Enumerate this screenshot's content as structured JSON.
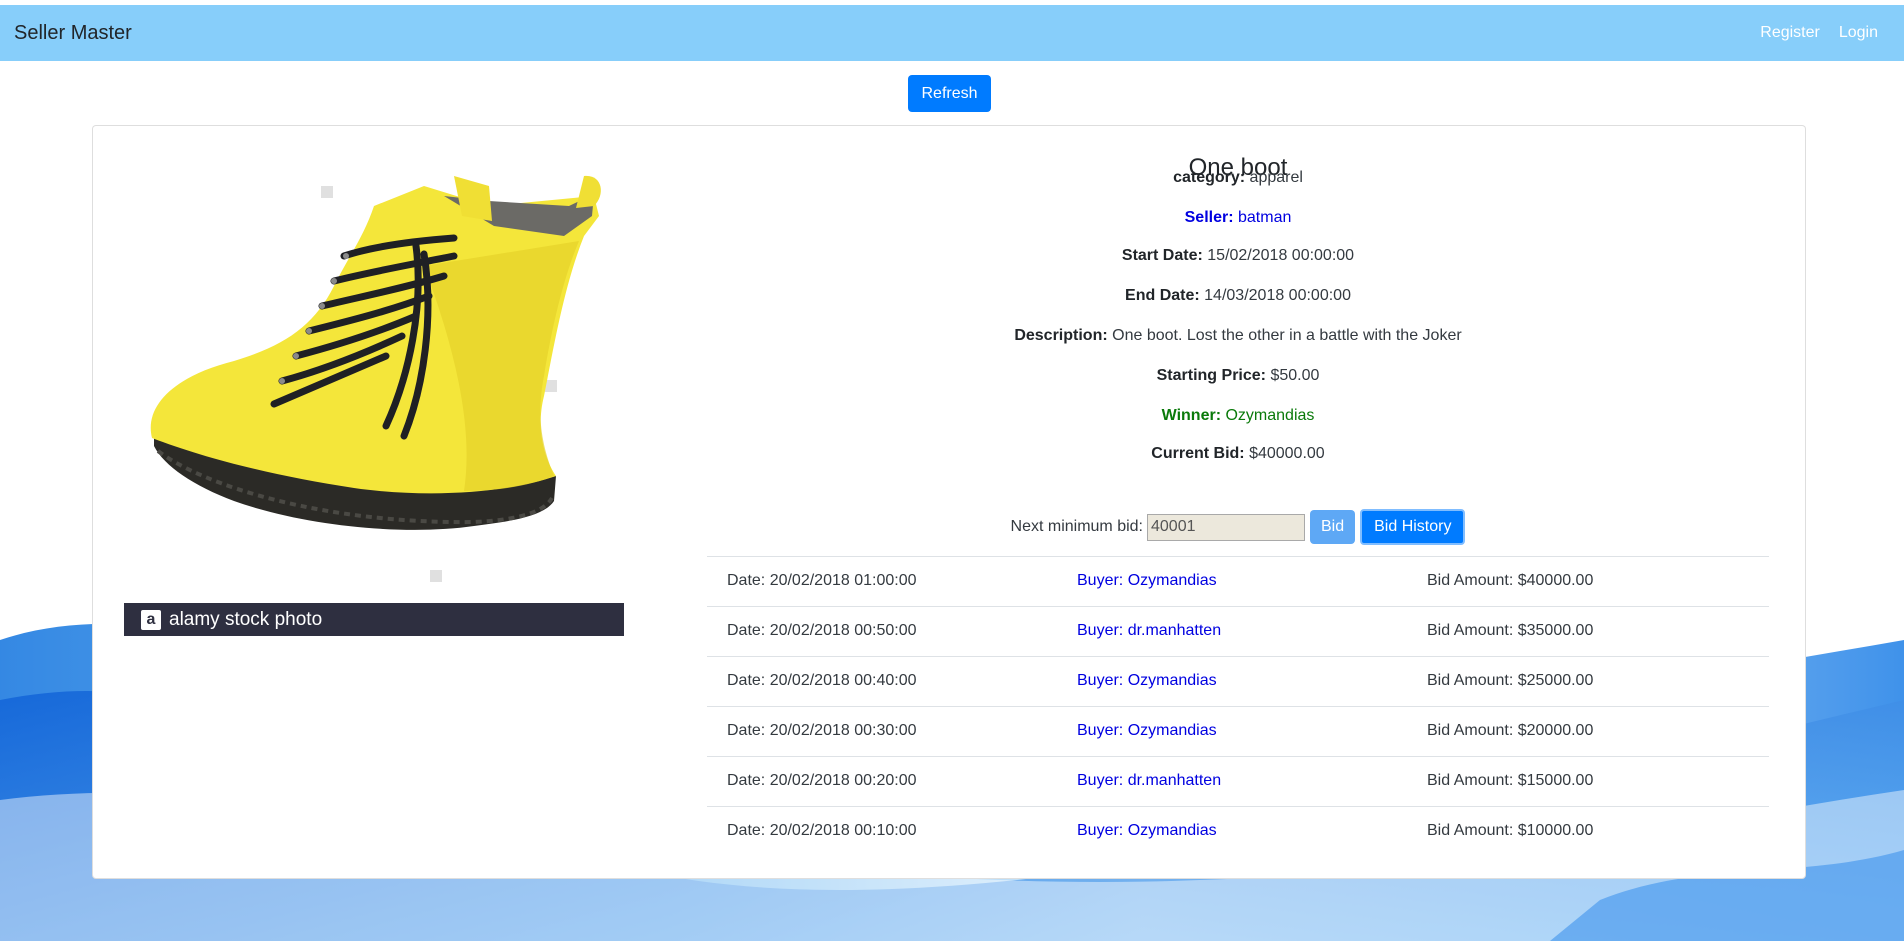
{
  "navbar": {
    "brand": "Seller Master",
    "register": "Register",
    "login": "Login"
  },
  "toolbar": {
    "refresh_label": "Refresh"
  },
  "product": {
    "title": "One boot",
    "photo_credit": "alamy stock photo",
    "photo_logo": "a",
    "photo_fine_print": "",
    "category_label": "category:",
    "category": "apparel",
    "seller_label": "Seller:",
    "seller": "batman",
    "start_label": "Start Date:",
    "start_date": "15/02/2018 00:00:00",
    "end_label": "End Date:",
    "end_date": "14/03/2018 00:00:00",
    "description_label": "Description:",
    "description": "One boot. Lost the other in a battle with the Joker",
    "starting_price_label": "Starting Price:",
    "starting_price": "$50.00",
    "winner_label": "Winner:",
    "winner": "Ozymandias",
    "current_bid_label": "Current Bid:",
    "current_bid": "$40000.00"
  },
  "bid_form": {
    "label": "Next minimum bid:",
    "value": "40001",
    "bid_label": "Bid",
    "history_label": "Bid History"
  },
  "bid_history": [
    {
      "date": "Date: 20/02/2018 01:00:00",
      "buyer": "Buyer: Ozymandias",
      "amount": "Bid Amount: $40000.00"
    },
    {
      "date": "Date: 20/02/2018 00:50:00",
      "buyer": "Buyer: dr.manhatten",
      "amount": "Bid Amount: $35000.00"
    },
    {
      "date": "Date: 20/02/2018 00:40:00",
      "buyer": "Buyer: Ozymandias",
      "amount": "Bid Amount: $25000.00"
    },
    {
      "date": "Date: 20/02/2018 00:30:00",
      "buyer": "Buyer: Ozymandias",
      "amount": "Bid Amount: $20000.00"
    },
    {
      "date": "Date: 20/02/2018 00:20:00",
      "buyer": "Buyer: dr.manhatten",
      "amount": "Bid Amount: $15000.00"
    },
    {
      "date": "Date: 20/02/2018 00:10:00",
      "buyer": "Buyer: Ozymandias",
      "amount": "Bid Amount: $10000.00"
    }
  ],
  "colors": {
    "navbar": "#87cefa",
    "primary": "#007bff",
    "seller": "#0000e0",
    "winner": "#0a7a0a"
  }
}
